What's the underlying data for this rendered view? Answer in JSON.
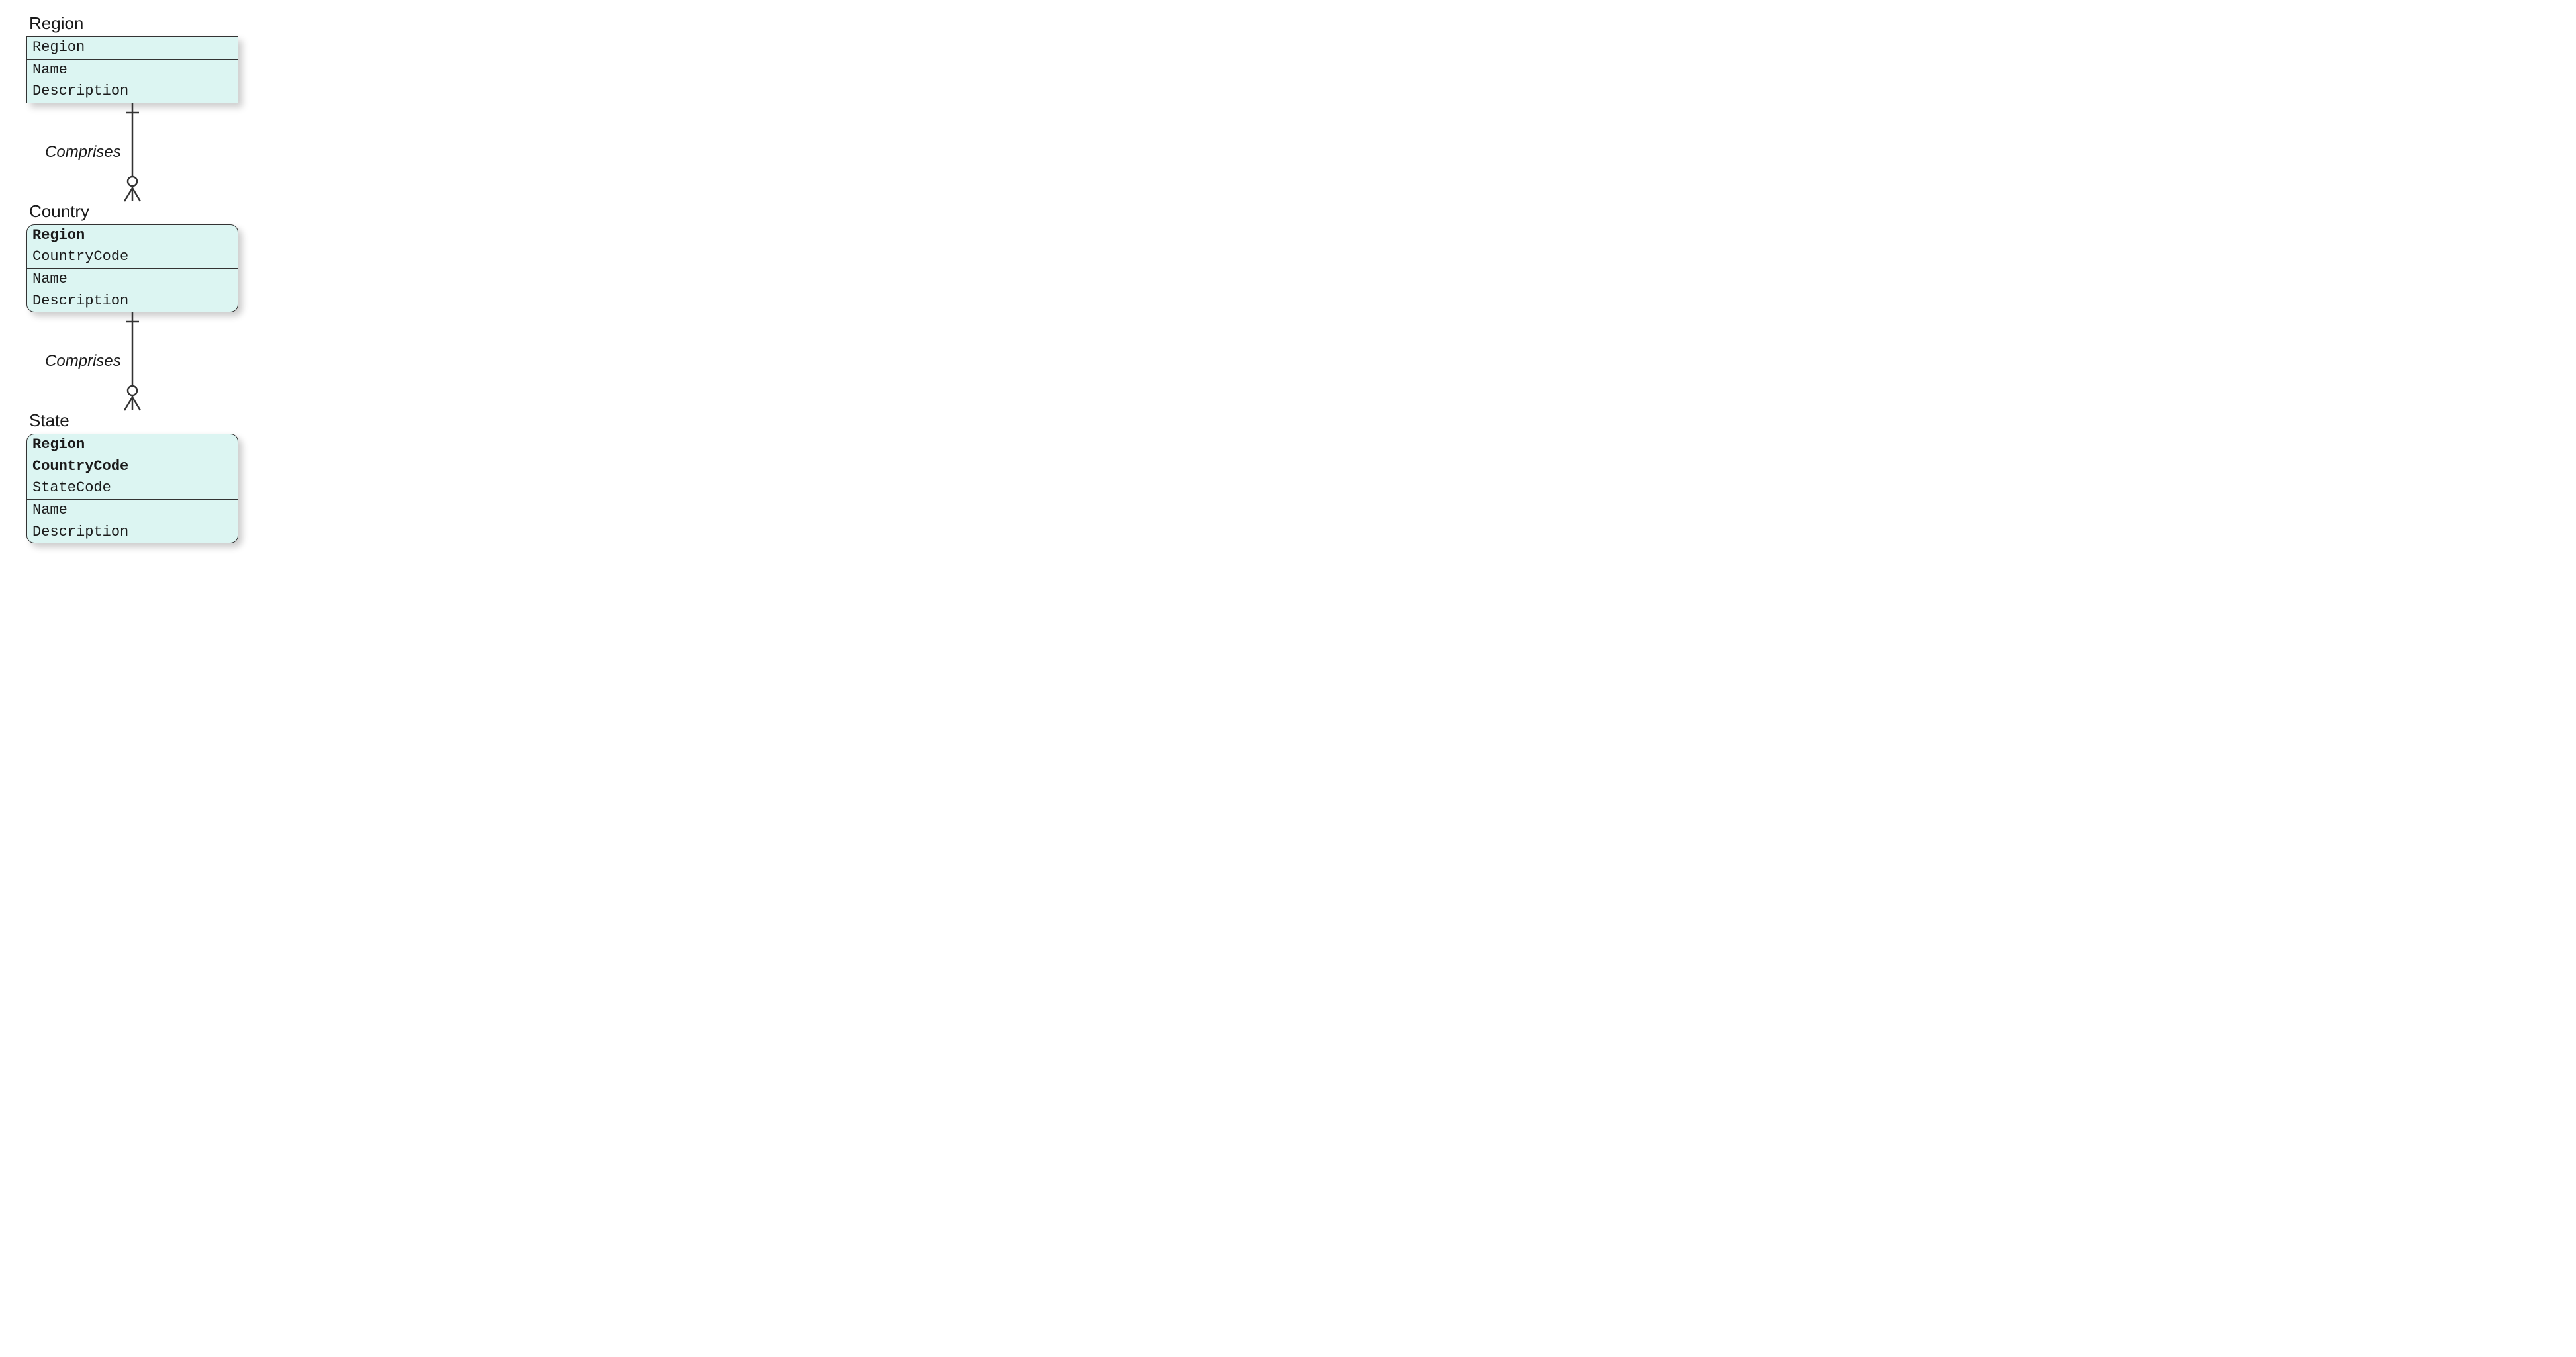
{
  "entities": [
    {
      "title": "Region",
      "rounded": false,
      "sections": [
        {
          "rows": [
            {
              "text": "Region",
              "bold": false
            }
          ]
        },
        {
          "rows": [
            {
              "text": "Name",
              "bold": false
            },
            {
              "text": "Description",
              "bold": false
            }
          ]
        }
      ]
    },
    {
      "title": "Country",
      "rounded": true,
      "sections": [
        {
          "rows": [
            {
              "text": "Region",
              "bold": true
            },
            {
              "text": "CountryCode",
              "bold": false
            }
          ]
        },
        {
          "rows": [
            {
              "text": "Name",
              "bold": false
            },
            {
              "text": "Description",
              "bold": false
            }
          ]
        }
      ]
    },
    {
      "title": "State",
      "rounded": true,
      "sections": [
        {
          "rows": [
            {
              "text": "Region",
              "bold": true
            },
            {
              "text": "CountryCode",
              "bold": true
            },
            {
              "text": "StateCode",
              "bold": false
            }
          ]
        },
        {
          "rows": [
            {
              "text": "Name",
              "bold": false
            },
            {
              "text": "Description",
              "bold": false
            }
          ]
        }
      ]
    }
  ],
  "relationships": [
    {
      "label": "Comprises"
    },
    {
      "label": "Comprises"
    }
  ]
}
